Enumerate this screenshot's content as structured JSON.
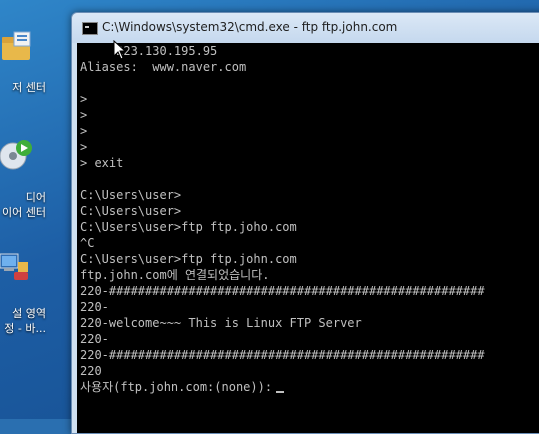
{
  "desktop": {
    "items": [
      {
        "label": "저 센터",
        "icon": "folder-control-icon"
      },
      {
        "label": "디어",
        "icon": "media-center-icon"
      },
      {
        "label": "이어 센터",
        "icon": ""
      },
      {
        "label": "설 영역",
        "icon": "network-icon"
      },
      {
        "label": "정 - 바...",
        "icon": ""
      }
    ]
  },
  "window": {
    "title": "C:\\Windows\\system32\\cmd.exe - ftp  ftp.john.com",
    "icon": "cmd-icon"
  },
  "console": {
    "lines": [
      "     223.130.195.95",
      "Aliases:  www.naver.com",
      "",
      ">",
      ">",
      ">",
      ">",
      "> exit",
      "",
      "C:\\Users\\user>",
      "C:\\Users\\user>",
      "C:\\Users\\user>ftp ftp.joho.com",
      "^C",
      "C:\\Users\\user>ftp ftp.john.com",
      "ftp.john.com에 연결되었습니다.",
      "220-####################################################",
      "220-",
      "220-welcome~~~ This is Linux FTP Server",
      "220-",
      "220-####################################################",
      "220",
      "사용자(ftp.john.com:(none)):"
    ]
  }
}
